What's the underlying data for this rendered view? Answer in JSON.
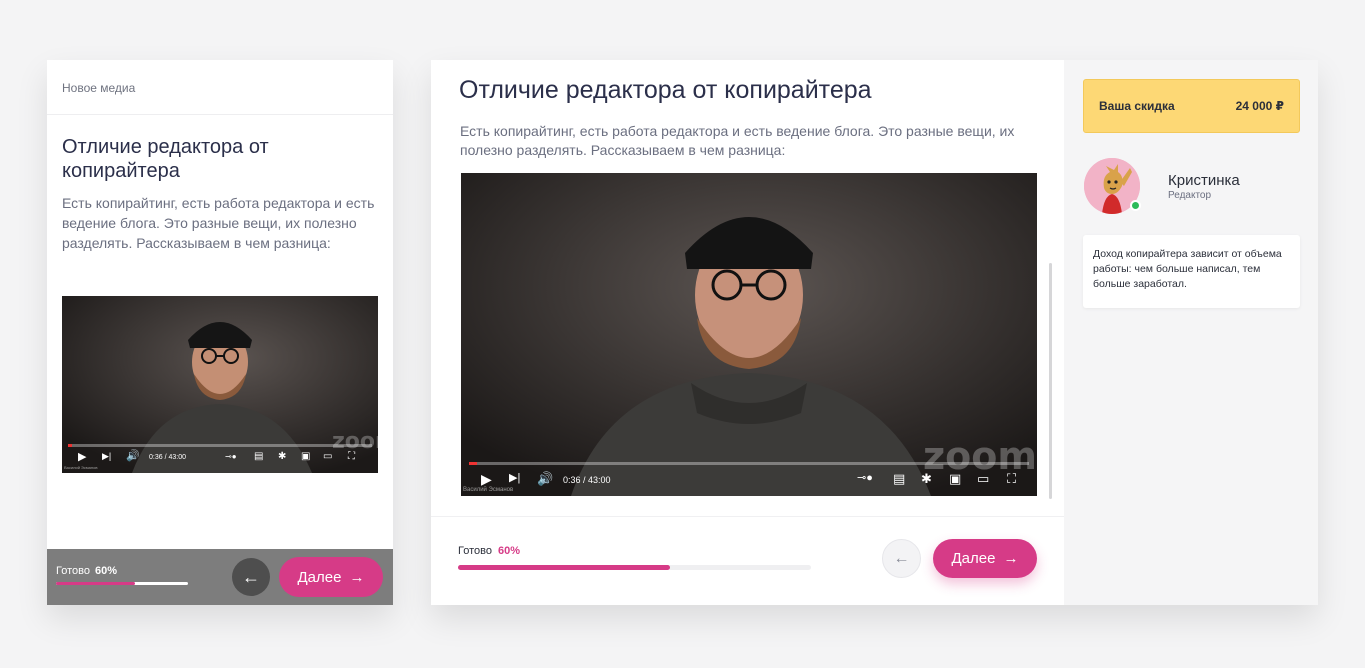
{
  "lesson": {
    "breadcrumb": "Новое медиа",
    "title": "Отличие редактора от копирайтера",
    "description": "Есть копирайтинг, есть работа редактора и есть ведение блога. Это разные вещи, их полезно разделять. Рассказываем в чем разница:"
  },
  "video": {
    "time": "0:36 / 43:00",
    "watermark": "zoom",
    "speaker_caption": "Василий Эсманов",
    "played_fraction": 0.014
  },
  "progress": {
    "label": "Готово",
    "value_text": "60%",
    "fraction": 0.6
  },
  "nav": {
    "next_label": "Далее",
    "next_icon": "arrow-right-icon",
    "back_icon": "arrow-left-icon"
  },
  "sidebar": {
    "discount_label": "Ваша скидка",
    "discount_value": "24 000 ₽",
    "author_name": "Кристинка",
    "author_role": "Редактор",
    "tip": "Доход копирайтера зависит от объема работы: чем больше написал, тем больше заработал."
  },
  "colors": {
    "accent": "#d63b87",
    "discount_bg": "#fdd875",
    "online": "#2dbb5a"
  }
}
